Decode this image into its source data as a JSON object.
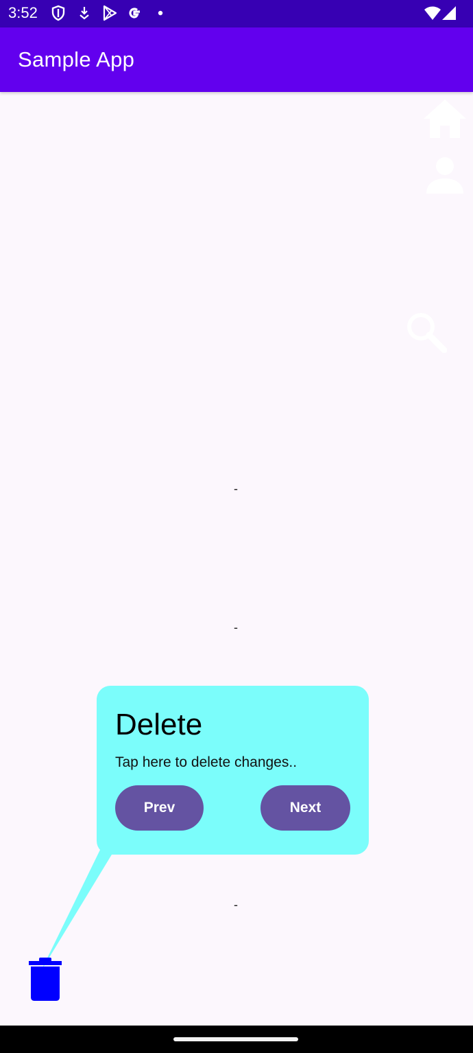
{
  "status_bar": {
    "time": "3:52",
    "left_icons": [
      "shield-icon",
      "download-icon",
      "play-store-icon",
      "google-icon",
      "dot-icon"
    ],
    "right_icons": [
      "wifi-icon",
      "signal-icon"
    ]
  },
  "app_bar": {
    "title": "Sample App"
  },
  "side_icons": [
    "home-icon",
    "person-icon",
    "search-icon"
  ],
  "placeholders": [
    "-",
    "-",
    "-"
  ],
  "tooltip": {
    "title": "Delete",
    "description": "Tap here to delete changes..",
    "prev_label": "Prev",
    "next_label": "Next"
  },
  "target_icon": "trash-icon",
  "colors": {
    "status_bar": "#3700b3",
    "app_bar": "#6200ee",
    "tooltip_bg": "#7bfdfb",
    "button_bg": "#6453a2",
    "trash": "#0000ff",
    "background": "#fcf7fd"
  }
}
